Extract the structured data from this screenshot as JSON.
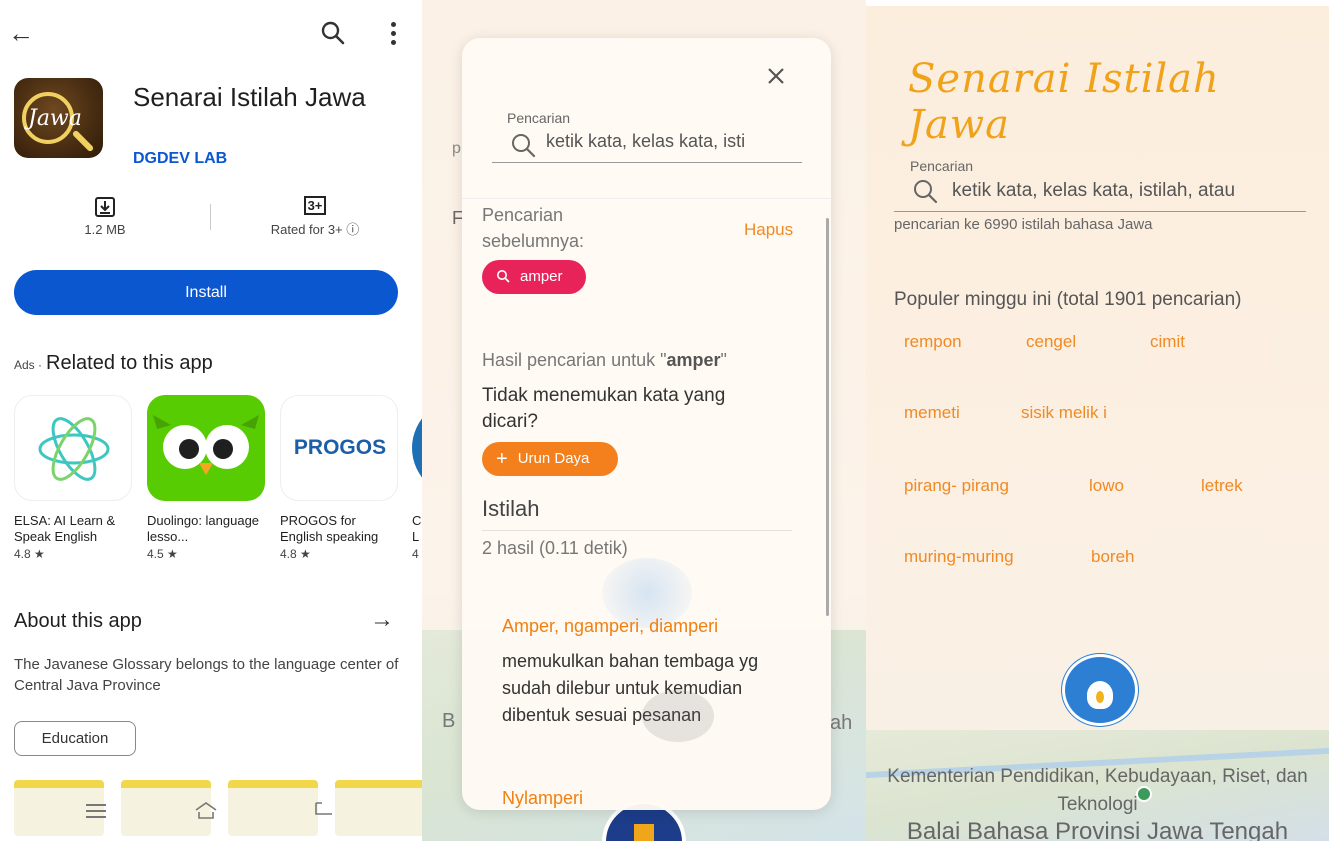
{
  "store": {
    "app_title": "Senarai Istilah Jawa",
    "icon_text": "Jawa",
    "developer": "DGDEV LAB",
    "size": "1.2 MB",
    "rating_badge": "3+",
    "rating_label": "Rated for 3+ ⓘ",
    "install_label": "Install",
    "ads_label": "Ads ·",
    "related_title": "Related to this app",
    "related": [
      {
        "name": "ELSA: AI Learn & Speak English",
        "rating": "4.8 ★"
      },
      {
        "name": "Duolingo: language lesso...",
        "rating": "4.5 ★"
      },
      {
        "name": "PROGOS for English speaking",
        "rating": "4.8 ★",
        "logo_text": "PROGOS"
      },
      {
        "name": "C L",
        "rating": "4"
      }
    ],
    "about_title": "About this app",
    "about_desc": "The Javanese Glossary belongs to the language center of Central Java Province",
    "category_chip": "Education"
  },
  "search_modal": {
    "bg_text_a": "p",
    "bg_text_f": "F",
    "bg_text_b": "B",
    "bg_text_h": "ah",
    "search_label": "Pencarian",
    "search_placeholder": "ketik kata, kelas kata, isti",
    "previous_label": "Pencarian sebelumnya:",
    "clear_label": "Hapus",
    "previous_chip": "amper",
    "result_prefix": "Hasil pencarian untuk \"",
    "result_query": "amper",
    "result_suffix": "\"",
    "not_found": "Tidak menemukan kata yang dicari?",
    "contribute_label": "Urun Daya",
    "section_title": "Istilah",
    "result_count": "2 hasil (0.11 detik)",
    "terms": [
      {
        "term": "Amper, ngamperi, diamperi",
        "definition": "memukulkan bahan tembaga yg sudah dilebur untuk kemudian dibentuk sesuai pesanan"
      },
      {
        "term": "Nylamperi",
        "definition": ""
      }
    ]
  },
  "home": {
    "app_title": "Senarai Istilah Jawa",
    "search_label": "Pencarian",
    "search_placeholder": "ketik kata, kelas kata, istilah, atau",
    "hint": "pencarian ke 6990 istilah bahasa Jawa",
    "popular_title": "Populer minggu ini (total 1901 pencarian)",
    "popular_words": [
      "rempon",
      "cengel",
      "cimit",
      "memeti",
      "sisik melik i",
      "pirang- pirang",
      "lowo",
      "letrek",
      "muring-muring",
      "boreh"
    ],
    "ministry": "Kementerian Pendidikan, Kebudayaan, Riset, dan Teknologi",
    "agency": "Balai Bahasa Provinsi Jawa Tengah"
  },
  "colors": {
    "install_blue": "#0b57d0",
    "accent_orange": "#f08a24",
    "chip_pink": "#e8235a",
    "title_gold": "#f0a21a"
  }
}
